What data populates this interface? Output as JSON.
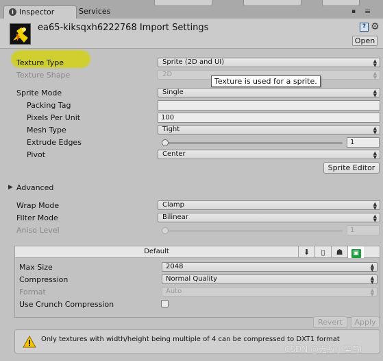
{
  "tabs": {
    "inspector": "Inspector",
    "services": "Services"
  },
  "header": {
    "title": "ea65-kiksqxh6222768 Import Settings",
    "open_label": "Open",
    "help_glyph": "?",
    "gear_glyph": "⚙"
  },
  "tooltip": "Texture is used for a sprite.",
  "fields": {
    "texture_type": {
      "label": "Texture Type",
      "value": "Sprite (2D and UI)"
    },
    "texture_shape": {
      "label": "Texture Shape",
      "value": "2D"
    },
    "sprite_mode": {
      "label": "Sprite Mode",
      "value": "Single"
    },
    "packing_tag": {
      "label": "Packing Tag",
      "value": ""
    },
    "pixels_per_unit": {
      "label": "Pixels Per Unit",
      "value": "100"
    },
    "mesh_type": {
      "label": "Mesh Type",
      "value": "Tight"
    },
    "extrude_edges": {
      "label": "Extrude Edges",
      "value": "1",
      "level": 0.0
    },
    "pivot": {
      "label": "Pivot",
      "value": "Center"
    },
    "sprite_editor": "Sprite Editor",
    "advanced": "Advanced",
    "wrap_mode": {
      "label": "Wrap Mode",
      "value": "Clamp"
    },
    "filter_mode": {
      "label": "Filter Mode",
      "value": "Bilinear"
    },
    "aniso_level": {
      "label": "Aniso Level",
      "value": "1",
      "level": 0.0
    }
  },
  "platform": {
    "title": "Default",
    "max_size": {
      "label": "Max Size",
      "value": "2048"
    },
    "compression": {
      "label": "Compression",
      "value": "Normal Quality"
    },
    "format": {
      "label": "Format",
      "value": "Auto"
    },
    "crunch": {
      "label": "Use Crunch Compression",
      "checked": false
    }
  },
  "buttons": {
    "revert": "Revert",
    "apply": "Apply"
  },
  "helpbox": "Only textures with width/height being multiple of 4 can be compressed to DXT1 format",
  "watermark": "CSDN @无敌小菜鸟i",
  "colors": {
    "highlight": "#d4d400",
    "panel": "#c2c2c2",
    "platform_selected": "#1e9e3e"
  }
}
